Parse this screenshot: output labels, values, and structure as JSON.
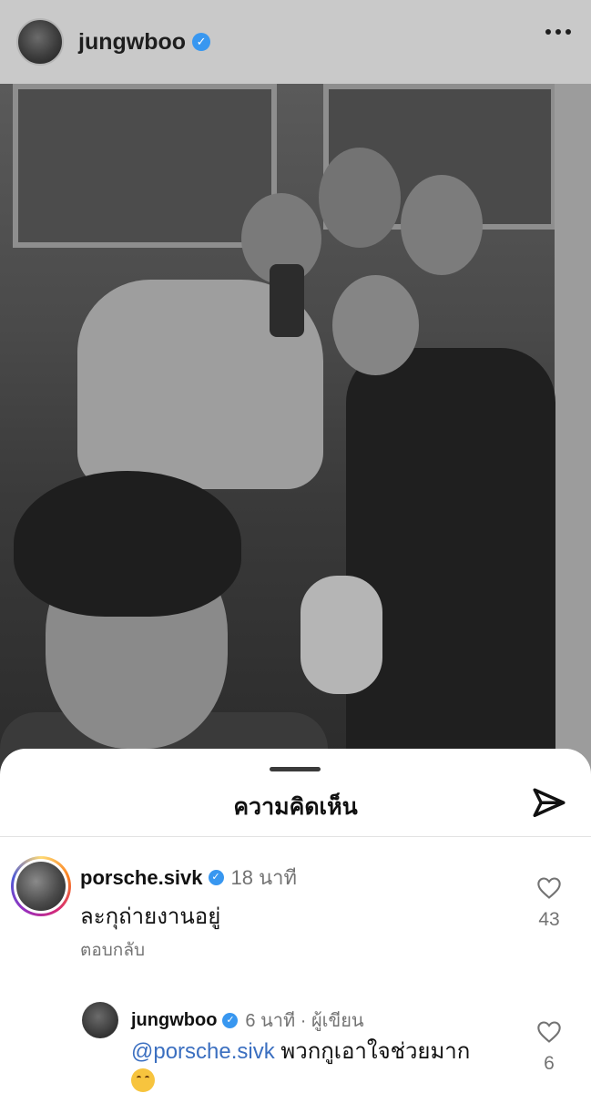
{
  "post": {
    "username": "jungwboo",
    "verified": true,
    "more_icon": "more-horizontal-icon"
  },
  "comments_sheet": {
    "title": "ความคิดเห็น",
    "share_icon": "send-icon"
  },
  "comments": [
    {
      "username": "porsche.sivk",
      "verified": true,
      "time": "18 นาที",
      "text": "ละกุถ่ายงานอยู่",
      "reply_label": "ตอบกลับ",
      "likes": "43"
    }
  ],
  "reply": {
    "username": "jungwboo",
    "verified": true,
    "time_and_role": "6 นาที · ผู้เขียน",
    "mention": "@porsche.sivk",
    "text": " พวกกูเอาใจช่วยมาก",
    "emoji": "face-with-tears-of-joy",
    "likes": "6"
  },
  "colors": {
    "verified": "#3897f0",
    "mention": "#3b6fc0",
    "muted_text": "#737373"
  }
}
